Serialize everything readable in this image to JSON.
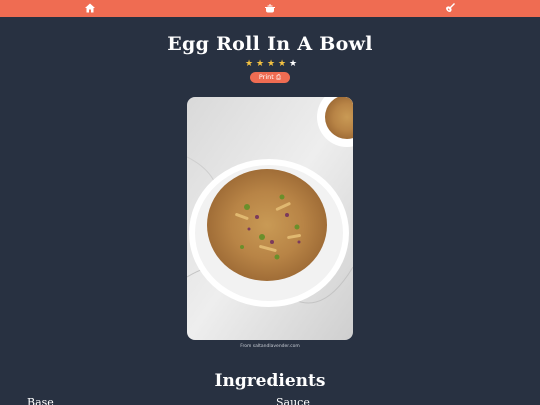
{
  "nav": {
    "icons": [
      "home-icon",
      "cooking-pot-icon",
      "whisk-icon"
    ]
  },
  "recipe": {
    "title": "Egg Roll In A Bowl",
    "rating": {
      "value": 4,
      "max": 5
    },
    "print_label": "Print",
    "print_icon": "printer-icon",
    "image_credit": "From saltandlavender.com"
  },
  "ingredients": {
    "heading": "Ingredients",
    "groups": [
      "Base",
      "Sauce"
    ]
  },
  "colors": {
    "background": "#283141",
    "accent": "#ef6c52",
    "star": "#f4c242"
  }
}
